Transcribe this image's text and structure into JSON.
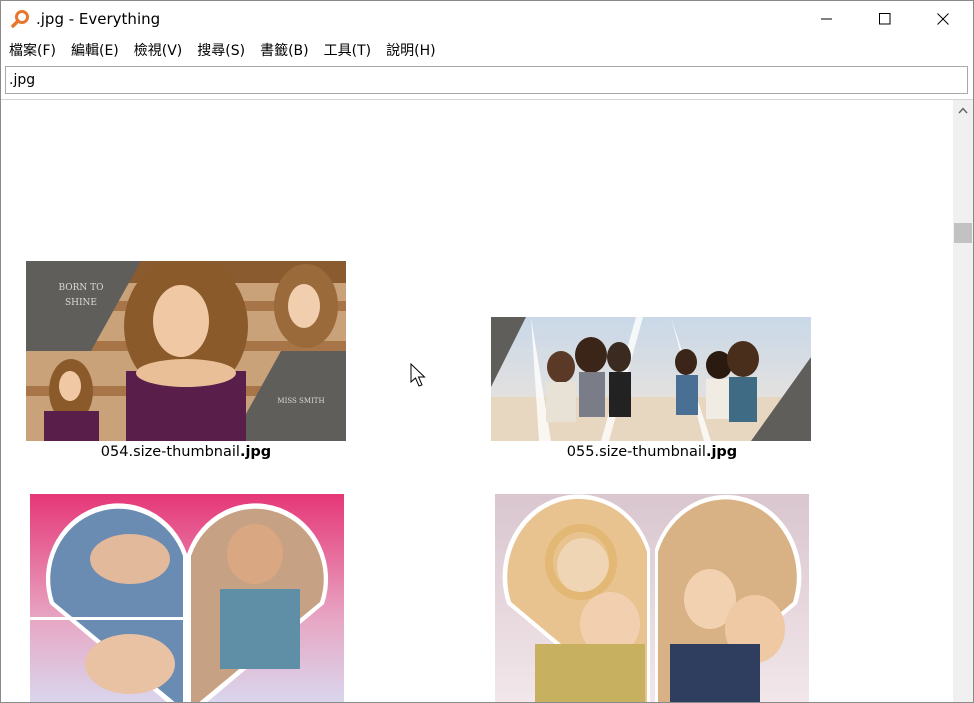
{
  "window": {
    "title": ".jpg - Everything"
  },
  "menu": {
    "items": [
      {
        "label": "檔案(F)"
      },
      {
        "label": "編輯(E)"
      },
      {
        "label": "檢視(V)"
      },
      {
        "label": "搜尋(S)"
      },
      {
        "label": "書籤(B)"
      },
      {
        "label": "工具(T)"
      },
      {
        "label": "說明(H)"
      }
    ]
  },
  "search": {
    "value": ".jpg"
  },
  "results": [
    {
      "name_prefix": "054.size-thumbnail",
      "name_match": ".jpg",
      "overlay_top": "BORN TO SHINE",
      "overlay_bottom": "MISS SMITH"
    },
    {
      "name_prefix": "055.size-thumbnail",
      "name_match": ".jpg"
    },
    {
      "name_prefix": "",
      "name_match": ""
    },
    {
      "name_prefix": "",
      "name_match": ""
    }
  ],
  "colors": {
    "accent": "#e8762b",
    "scroll_thumb": "#c2c2c2",
    "border": "#a8a8a8"
  }
}
